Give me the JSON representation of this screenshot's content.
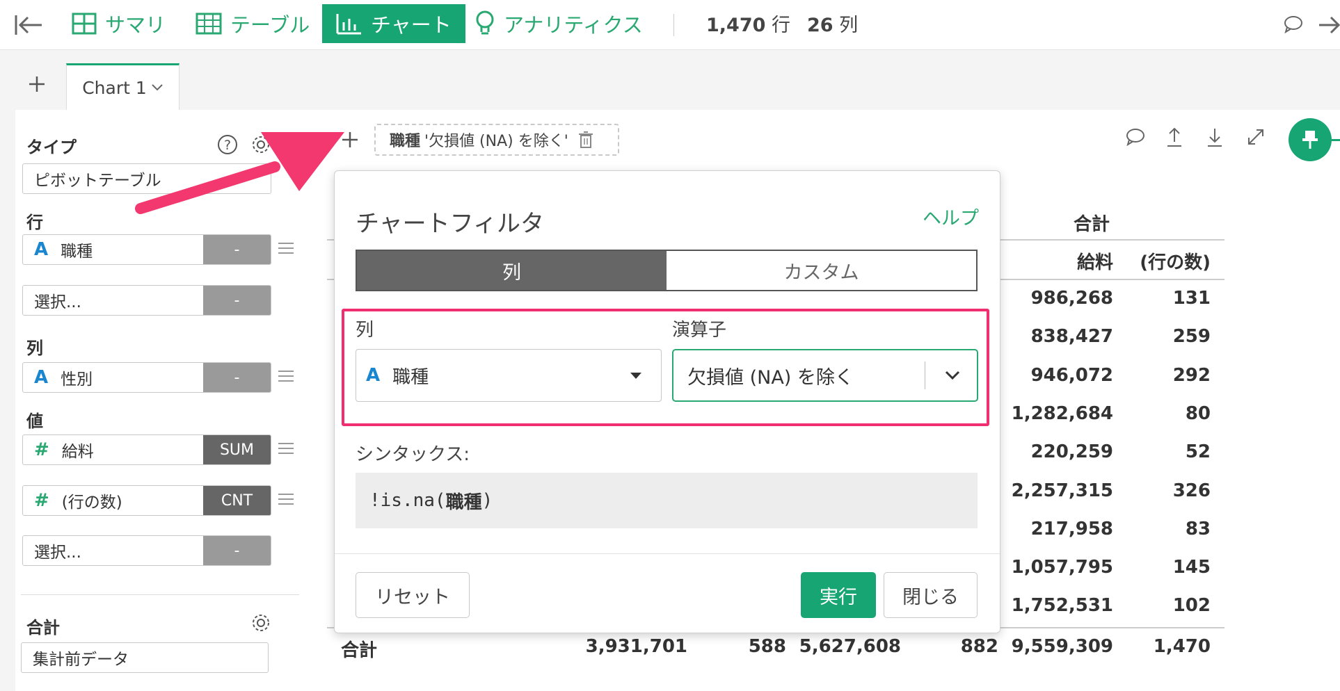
{
  "toolbar": {
    "summary": "サマリ",
    "table": "テーブル",
    "chart": "チャート",
    "analytics": "アナリティクス",
    "rows_count": "1,470",
    "rows_unit": "行",
    "cols_count": "26",
    "cols_unit": "列"
  },
  "tabs": {
    "active": "Chart 1"
  },
  "filter_chip": {
    "column": "職種",
    "condition": "'欠損値 (NA) を除く'"
  },
  "left_panel": {
    "type_label": "タイプ",
    "type_value": "ピボットテーブル",
    "rows_label": "行",
    "rows_field": "職種",
    "rows_field_agg": "-",
    "rows_select": "選択...",
    "rows_select_agg": "-",
    "cols_label": "列",
    "cols_field": "性別",
    "cols_field_agg": "-",
    "values_label": "値",
    "value1_field": "給料",
    "value1_agg": "SUM",
    "value2_field": "(行の数)",
    "value2_agg": "CNT",
    "values_select": "選択...",
    "values_select_agg": "-",
    "total_label": "合計",
    "total_value": "集計前データ"
  },
  "table": {
    "header_group": "合計",
    "col_salary": "給料",
    "col_count": "(行の数)",
    "rows": [
      {
        "salary": "986,268",
        "count": "131"
      },
      {
        "salary": "838,427",
        "count": "259"
      },
      {
        "salary": "946,072",
        "count": "292"
      },
      {
        "salary": "1,282,684",
        "count": "80"
      },
      {
        "salary": "220,259",
        "count": "52"
      },
      {
        "salary": "2,257,315",
        "count": "326"
      },
      {
        "salary": "217,958",
        "count": "83"
      },
      {
        "salary": "1,057,795",
        "count": "145"
      },
      {
        "salary": "1,752,531",
        "count": "102"
      }
    ],
    "total_label": "合計",
    "total_values": [
      "3,931,701",
      "588",
      "5,627,608",
      "882",
      "9,559,309",
      "1,470"
    ]
  },
  "modal": {
    "title": "チャートフィルタ",
    "help": "ヘルプ",
    "seg_col": "列",
    "seg_custom": "カスタム",
    "col_label": "列",
    "op_label": "演算子",
    "col_value": "職種",
    "op_value": "欠損値 (NA) を除く",
    "syntax_label": "シンタックス:",
    "syntax_prefix": "!is.na(",
    "syntax_col": "職種",
    "syntax_suffix": ")",
    "reset": "リセット",
    "run": "実行",
    "close": "閉じる"
  },
  "colors": {
    "accent": "#17a574",
    "highlight": "#ef2f6f",
    "arrow": "#f2386f"
  }
}
